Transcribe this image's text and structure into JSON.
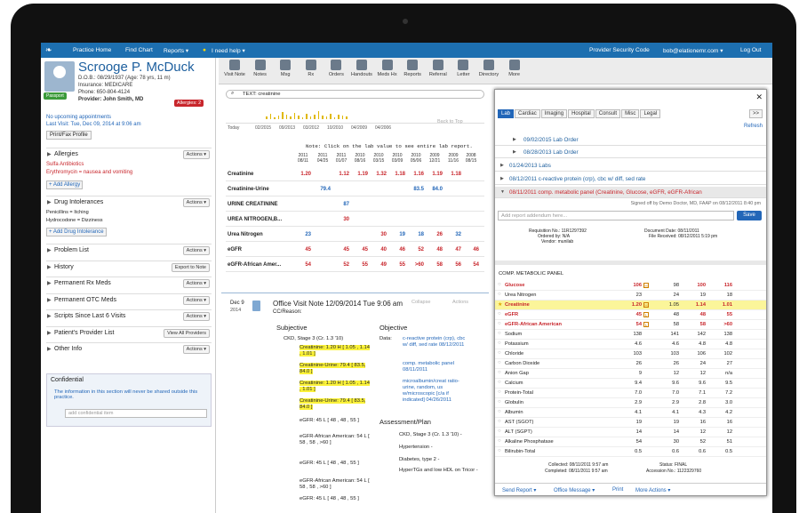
{
  "topbar": {
    "practice_home": "Practice Home",
    "find_chart": "Find Chart",
    "reports": "Reports ▾",
    "help": "I need help ▾",
    "security": "Provider Security Code",
    "user": "bob@elationemr.com ▾",
    "logout": "Log Out"
  },
  "toolbar": [
    "Visit Note",
    "Notes",
    "Msg",
    "Rx",
    "Orders",
    "Handouts",
    "Meds Hx",
    "Reports",
    "Referral",
    "Letter",
    "Directory",
    "More"
  ],
  "patient": {
    "name": "Scrooge P. McDuck",
    "dob": "D.O.B.: 08/29/1937 (Age: 78 yrs, 11 m)",
    "insurance": "Insurance: MEDICARE",
    "phone": "Phone: 650-804-4124",
    "provider": "Provider: John Smith, MD",
    "allergies_badge": "Allergies: 2",
    "passport": "Passport"
  },
  "appointments": {
    "none": "No upcoming appointments",
    "last_visit": "Last Visit: Tue, Dec 09, 2014 at 9:06 am",
    "print": "Print/Fax Profile"
  },
  "allergies": {
    "title": "Allergies",
    "items": [
      "Sulfa Antibiotics",
      "Erythromycin = nausea and vomiting"
    ],
    "add": "+ Add Allergy",
    "actions": "Actions ▾"
  },
  "intolerances": {
    "title": "Drug Intolerances",
    "items": [
      "Penicillins = Itching",
      "Hydrocodone = Dizziness"
    ],
    "add": "+ Add Drug Intolerance",
    "actions": "Actions ▾"
  },
  "sections": [
    {
      "title": "Problem List",
      "btn": "Actions ▾"
    },
    {
      "title": "History",
      "btn": "Export to Note"
    },
    {
      "title": "Permanent Rx Meds",
      "btn": "Actions ▾"
    },
    {
      "title": "Permanent OTC Meds",
      "btn": "Actions ▾"
    },
    {
      "title": "Scripts Since Last 6 Visits",
      "btn": "Actions ▾"
    },
    {
      "title": "Patient's Provider List",
      "btn": "View All Providers"
    },
    {
      "title": "Other Info",
      "btn": "Actions ▾"
    }
  ],
  "confidential": {
    "title": "Confidential",
    "msg": "The information in this section will never be shared outside this practice.",
    "placeholder": "add confidential item"
  },
  "search": {
    "chip": "TEXT: creatinine"
  },
  "timeline": {
    "today": "Today",
    "labels": [
      "02/2015",
      "09/2013",
      "03/2012",
      "10/2010",
      "04/2009",
      "04/2006"
    ],
    "back": "Back to Top"
  },
  "lab_note": "Note: Click on the lab value to see entire lab report.",
  "lab_dates": [
    [
      "2011",
      "08/11"
    ],
    [
      "2011",
      "04/25"
    ],
    [
      "2011",
      "01/07"
    ],
    [
      "2010",
      "08/16"
    ],
    [
      "2010",
      "03/15"
    ],
    [
      "2010",
      "03/09"
    ],
    [
      "2010",
      "05/06"
    ],
    [
      "2009",
      "12/21"
    ],
    [
      "2009",
      "11/16"
    ],
    [
      "2008",
      "08/15"
    ]
  ],
  "lab_rows": [
    {
      "name": "Creatinine",
      "vals": [
        "1.20",
        "",
        "1.12",
        "1.19",
        "1.32",
        "1.18",
        "1.16",
        "1.19",
        "1.18",
        ""
      ]
    },
    {
      "name": "Creatinine-Urine",
      "vals": [
        "",
        "79.4",
        "",
        "",
        "",
        "",
        "83.5",
        "84.0",
        "",
        ""
      ]
    },
    {
      "name": "URINE CREATININE",
      "vals": [
        "",
        "",
        "87",
        "",
        "",
        "",
        "",
        "",
        "",
        ""
      ]
    },
    {
      "name": "UREA NITROGEN,B...",
      "vals": [
        "",
        "",
        "30",
        "",
        "",
        "",
        "",
        "",
        "",
        ""
      ]
    },
    {
      "name": "Urea Nitrogen",
      "vals": [
        "23",
        "",
        "",
        "",
        "30",
        "19",
        "18",
        "26",
        "32",
        ""
      ]
    },
    {
      "name": "eGFR",
      "vals": [
        "45",
        "",
        "45",
        "45",
        "40",
        "46",
        "52",
        "48",
        "47",
        "46"
      ]
    },
    {
      "name": "eGFR-African Amer...",
      "vals": [
        "54",
        "",
        "52",
        "55",
        "49",
        "55",
        ">60",
        "58",
        "56",
        "54"
      ]
    }
  ],
  "visit_note": {
    "date": "Dec 9",
    "year": "2014",
    "title": "Office Visit Note 12/09/2014 Tue 9:06 am",
    "cc": "CC/Reason:",
    "collapse": "Collapse",
    "actions": "Actions",
    "subjective": "Subjective",
    "objective": "Objective",
    "assessment": "Assessment/Plan",
    "subj_items": [
      "CKD, Stage 3 (Cr. 1.3 '10)",
      "Creatinine: 1.20 H [ 1.05 , 1.14 , 1.01 ]",
      "Creatinine-Urine: 79.4 [ 83.5, 84.0 ]",
      "Creatinine: 1.20 H [ 1.05 , 1.14 , 1.01 ]",
      "Creatinine-Urine: 79.4 [ 83.5, 84.0 ]",
      "eGFR: 45 L [ 48 , 48 , 55 ]",
      "eGFR-African American: 54 L [ 58 , 58 , >60 ]",
      "eGFR: 45 L [ 48 , 48 , 55 ]",
      "eGFR-African American: 54 L [ 58 , 58 , >60 ]",
      "eGFR: 45 L [ 48 , 48 , 55 ]"
    ],
    "obj_data": "Data:",
    "obj_items": [
      "c-reactive protein (crp), cbc w/ diff, sed rate 08/12/2011",
      "comp. metabolic panel 08/11/2011",
      "microalbumin/creat ratio-urine, random, us w/microscopic [c/a if indicated] 04/26/2011"
    ],
    "assess_items": [
      "CKD, Stage 3 (Cr. 1.3 '10) -",
      "Hypertension -",
      "Diabetes, type 2 -",
      "HyperTGs and low HDL on Tricor -"
    ]
  },
  "right": {
    "tabs": [
      "Lab",
      "Cardiac",
      "Imaging",
      "Hospital",
      "Consult",
      "Misc",
      "Legal"
    ],
    "more": ">>",
    "refresh": "Refresh",
    "orders": [
      "09/02/2015  Lab Order",
      "08/28/2013  Lab Order",
      "01/24/2013  Labs",
      "08/12/2011  c-reactive protein (crp), cbc w/ diff, sed rate",
      "08/11/2011  comp. metabolic panel (Creatinine, Glucose, eGFR, eGFR-African"
    ],
    "signed": "Signed off by Demo Doctor, MD, FAAP on 08/12/2011 8:40 pm",
    "addendum": "Add report addendum here...",
    "save": "Save",
    "req": "Requisition No.: 11R1297392",
    "ordered": "Ordered by: N/A",
    "vendor": "Vendor: munilab",
    "docdate": "Document Date: 08/11/2011",
    "filerecv": "File Received: 08/12/2011 5:19 pm",
    "panel": "COMP. METABOLIC PANEL",
    "results": [
      {
        "n": "Glucose",
        "v": "106",
        "a": "98",
        "b": "100",
        "c": "116",
        "flag": true
      },
      {
        "n": "Urea Nitrogen",
        "v": "23",
        "a": "24",
        "b": "19",
        "c": "18",
        "flag": false
      },
      {
        "n": "Creatinine",
        "v": "1.20",
        "a": "1.05",
        "b": "1.14",
        "c": "1.01",
        "flag": true,
        "hl": true
      },
      {
        "n": "eGFR",
        "v": "45",
        "a": "48",
        "b": "48",
        "c": "55",
        "flag": true
      },
      {
        "n": "eGFR-African American",
        "v": "54",
        "a": "58",
        "b": "58",
        "c": ">60",
        "flag": true
      },
      {
        "n": "Sodium",
        "v": "138",
        "a": "141",
        "b": "142",
        "c": "138",
        "flag": false
      },
      {
        "n": "Potassium",
        "v": "4.6",
        "a": "4.6",
        "b": "4.8",
        "c": "4.8",
        "flag": false
      },
      {
        "n": "Chloride",
        "v": "103",
        "a": "103",
        "b": "106",
        "c": "102",
        "flag": false
      },
      {
        "n": "Carbon Dioxide",
        "v": "26",
        "a": "26",
        "b": "24",
        "c": "27",
        "flag": false
      },
      {
        "n": "Anion Gap",
        "v": "9",
        "a": "12",
        "b": "12",
        "c": "n/a",
        "flag": false
      },
      {
        "n": "Calcium",
        "v": "9.4",
        "a": "9.6",
        "b": "9.6",
        "c": "9.5",
        "flag": false
      },
      {
        "n": "Protein-Total",
        "v": "7.0",
        "a": "7.0",
        "b": "7.1",
        "c": "7.2",
        "flag": false
      },
      {
        "n": "Globulin",
        "v": "2.9",
        "a": "2.9",
        "b": "2.8",
        "c": "3.0",
        "flag": false
      },
      {
        "n": "Albumin",
        "v": "4.1",
        "a": "4.1",
        "b": "4.3",
        "c": "4.2",
        "flag": false
      },
      {
        "n": "AST (SGOT)",
        "v": "19",
        "a": "19",
        "b": "16",
        "c": "16",
        "flag": false
      },
      {
        "n": "ALT (SGPT)",
        "v": "14",
        "a": "14",
        "b": "12",
        "c": "12",
        "flag": false
      },
      {
        "n": "Alkaline Phosphatase",
        "v": "54",
        "a": "30",
        "b": "52",
        "c": "51",
        "flag": false
      },
      {
        "n": "Bilirubin-Total",
        "v": "0.5",
        "a": "0.6",
        "b": "0.6",
        "c": "0.5",
        "flag": false
      }
    ],
    "collected": "Collected: 08/11/2011 9:57 am",
    "completed": "Completed: 08/11/2011 9:57 am",
    "status": "Status: FINAL",
    "accession": "Accession No.: 1122329760",
    "bottom": [
      "Send Report ▾",
      "Office Message ▾",
      "Print",
      "More Actions ▾"
    ]
  }
}
